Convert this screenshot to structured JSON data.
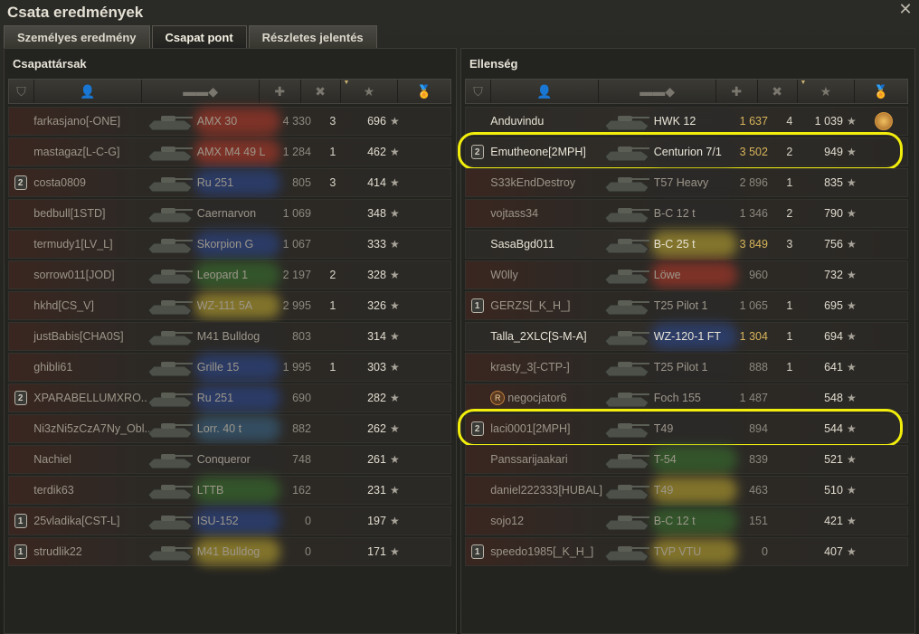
{
  "window": {
    "title": "Csata eredmények"
  },
  "tabs": [
    {
      "label": "Személyes eredmény",
      "active": false
    },
    {
      "label": "Csapat pont",
      "active": true
    },
    {
      "label": "Részletes jelentés",
      "active": false
    }
  ],
  "panels": {
    "left": {
      "title": "Csapattársak",
      "rows": [
        {
          "badge": "",
          "name": "farkasjano[-ONE]",
          "tank": "AMX 30",
          "dmg": "4 330",
          "kills": "3",
          "xp": "696",
          "medal": "",
          "alive": false,
          "nation": "#c03a2a"
        },
        {
          "badge": "",
          "name": "mastagaz[L-C-G]",
          "tank": "AMX M4 49 L",
          "dmg": "1 284",
          "kills": "1",
          "xp": "462",
          "medal": "",
          "alive": false,
          "nation": "#c03a2a"
        },
        {
          "badge": "2",
          "name": "costa0809",
          "tank": "Ru 251",
          "dmg": "805",
          "kills": "3",
          "xp": "414",
          "medal": "",
          "alive": false,
          "nation": "#2a4a9a"
        },
        {
          "badge": "",
          "name": "bedbull[1STD]",
          "tank": "Caernarvon",
          "dmg": "1 069",
          "kills": "",
          "xp": "348",
          "medal": "",
          "alive": false,
          "nation": "#2a2a2a"
        },
        {
          "badge": "",
          "name": "termudy1[LV_L]",
          "tank": "Skorpion G",
          "dmg": "1 067",
          "kills": "",
          "xp": "333",
          "medal": "",
          "alive": false,
          "nation": "#2a4a9a"
        },
        {
          "badge": "",
          "name": "sorrow011[JOD]",
          "tank": "Leopard 1",
          "dmg": "2 197",
          "kills": "2",
          "xp": "328",
          "medal": "",
          "alive": false,
          "nation": "#3a7a30"
        },
        {
          "badge": "",
          "name": "hkhd[CS_V]",
          "tank": "WZ-111 5A",
          "dmg": "2 995",
          "kills": "1",
          "xp": "326",
          "medal": "",
          "alive": false,
          "nation": "#c8b030"
        },
        {
          "badge": "",
          "name": "justBabis[CHA0S]",
          "tank": "M41 Bulldog",
          "dmg": "803",
          "kills": "",
          "xp": "314",
          "medal": "",
          "alive": false,
          "nation": "#2a2a2a"
        },
        {
          "badge": "",
          "name": "ghibli61",
          "tank": "Grille 15",
          "dmg": "1 995",
          "kills": "1",
          "xp": "303",
          "medal": "",
          "alive": false,
          "nation": "#2a4a9a"
        },
        {
          "badge": "2",
          "name": "XPARABELLUMXRO..",
          "tank": "Ru 251",
          "dmg": "690",
          "kills": "",
          "xp": "282",
          "medal": "",
          "alive": false,
          "nation": "#2a4a9a"
        },
        {
          "badge": "",
          "name": "Ni3zNi5zCzA7Ny_Obl..",
          "tank": "Lorr. 40 t",
          "dmg": "882",
          "kills": "",
          "xp": "262",
          "medal": "",
          "alive": false,
          "nation": "#3a6a90"
        },
        {
          "badge": "",
          "name": "Nachiel",
          "tank": "Conqueror",
          "dmg": "748",
          "kills": "",
          "xp": "261",
          "medal": "",
          "alive": false,
          "nation": "#2a2a2a"
        },
        {
          "badge": "",
          "name": "terdik63",
          "tank": "LTTB",
          "dmg": "162",
          "kills": "",
          "xp": "231",
          "medal": "",
          "alive": false,
          "nation": "#3a7a30"
        },
        {
          "badge": "1",
          "name": "25vladika[CST-L]",
          "tank": "ISU-152",
          "dmg": "0",
          "kills": "",
          "xp": "197",
          "medal": "",
          "alive": false,
          "nation": "#2a4a9a"
        },
        {
          "badge": "1",
          "name": "strudlik22",
          "tank": "M41 Bulldog",
          "dmg": "0",
          "kills": "",
          "xp": "171",
          "medal": "",
          "alive": false,
          "nation": "#c8b030"
        }
      ]
    },
    "right": {
      "title": "Ellenség",
      "rows": [
        {
          "badge": "",
          "name": "Anduvindu",
          "tank": "HWK 12",
          "dmg": "1 637",
          "kills": "4",
          "xp": "1 039",
          "medal": "ace",
          "alive": true,
          "nation": "#2a2a2a"
        },
        {
          "badge": "2",
          "name": "Emutheone[2MPH]",
          "tank": "Centurion 7/1",
          "dmg": "3 502",
          "kills": "2",
          "xp": "949",
          "medal": "",
          "alive": true,
          "nation": "#2a2a2a",
          "highlight": true
        },
        {
          "badge": "",
          "name": "S33kEndDestroy",
          "tank": "T57 Heavy",
          "dmg": "2 896",
          "kills": "1",
          "xp": "835",
          "medal": "",
          "alive": false,
          "nation": "#2a2a2a"
        },
        {
          "badge": "",
          "name": "vojtass34",
          "tank": "B-C 12 t",
          "dmg": "1 346",
          "kills": "2",
          "xp": "790",
          "medal": "",
          "alive": false,
          "nation": "#2a2a2a"
        },
        {
          "badge": "",
          "name": "SasaBgd011",
          "tank": "B-C 25 t",
          "dmg": "3 849",
          "kills": "3",
          "xp": "756",
          "medal": "",
          "alive": true,
          "nation": "#c8b030"
        },
        {
          "badge": "",
          "name": "W0lly",
          "tank": "Löwe",
          "dmg": "960",
          "kills": "",
          "xp": "732",
          "medal": "",
          "alive": false,
          "nation": "#c03a2a"
        },
        {
          "badge": "1",
          "name": "GERZS[_K_H_]",
          "tank": "T25 Pilot 1",
          "dmg": "1 065",
          "kills": "1",
          "xp": "695",
          "medal": "",
          "alive": false,
          "nation": "#2a2a2a"
        },
        {
          "badge": "",
          "name": "Talla_2XLC[S-M-A]",
          "tank": "WZ-120-1 FT",
          "dmg": "1 304",
          "kills": "1",
          "xp": "694",
          "medal": "",
          "alive": true,
          "nation": "#2a4a9a"
        },
        {
          "badge": "",
          "name": "krasty_3[-CTP-]",
          "tank": "T25 Pilot 1",
          "dmg": "888",
          "kills": "1",
          "xp": "641",
          "medal": "",
          "alive": false,
          "nation": "#2a2a2a"
        },
        {
          "badge": "",
          "name": "negocjator6",
          "tank": "Foch 155",
          "dmg": "1 487",
          "kills": "",
          "xp": "548",
          "medal": "",
          "alive": false,
          "nation": "#2a2a2a",
          "clan_icon": "R"
        },
        {
          "badge": "2",
          "name": "laci0001[2MPH]",
          "tank": "T49",
          "dmg": "894",
          "kills": "",
          "xp": "544",
          "medal": "",
          "alive": false,
          "nation": "#2a2a2a",
          "highlight": true
        },
        {
          "badge": "",
          "name": "Panssarijaakari",
          "tank": "T-54",
          "dmg": "839",
          "kills": "",
          "xp": "521",
          "medal": "",
          "alive": false,
          "nation": "#3a7a30"
        },
        {
          "badge": "",
          "name": "daniel222333[HUBAL]",
          "tank": "T49",
          "dmg": "463",
          "kills": "",
          "xp": "510",
          "medal": "",
          "alive": false,
          "nation": "#c8b030"
        },
        {
          "badge": "",
          "name": "sojo12",
          "tank": "B-C 12 t",
          "dmg": "151",
          "kills": "",
          "xp": "421",
          "medal": "",
          "alive": false,
          "nation": "#3a7a30"
        },
        {
          "badge": "1",
          "name": "speedo1985[_K_H_]",
          "tank": "TVP VTU",
          "dmg": "0",
          "kills": "",
          "xp": "407",
          "medal": "",
          "alive": false,
          "nation": "#c8b030"
        }
      ]
    }
  },
  "header_icons": [
    "rank-badge-icon",
    "player-icon",
    "tank-icon",
    "damage-icon",
    "kills-icon",
    "experience-star-icon",
    "medal-icon"
  ]
}
